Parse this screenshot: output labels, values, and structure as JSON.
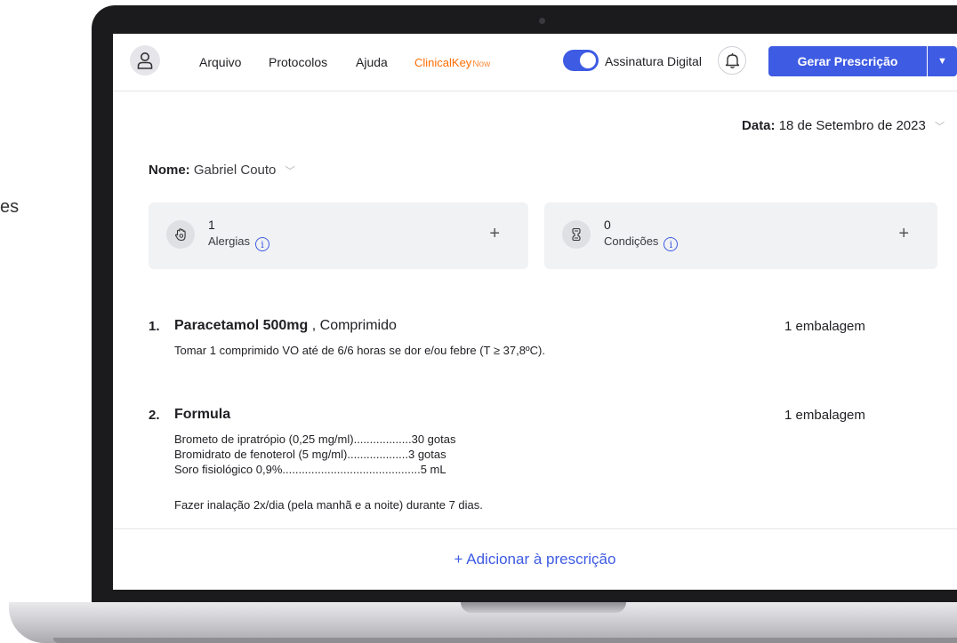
{
  "side_fragment": "es",
  "header": {
    "nav": [
      "Arquivo",
      "Protocolos",
      "Ajuda"
    ],
    "clinicalkey": {
      "main": "ClinicalKey",
      "suffix": "Now"
    },
    "toggle_label": "Assinatura Digital",
    "toggle_on": true,
    "primary_button": "Gerar Prescrição",
    "dropdown_glyph": "▼"
  },
  "date": {
    "label": "Data:",
    "value": "18 de Setembro de 2023"
  },
  "patient": {
    "label": "Nome:",
    "value": "Gabriel Couto"
  },
  "cards": [
    {
      "count": "1",
      "label": "Alergias",
      "icon": "hand-icon",
      "plus": "+"
    },
    {
      "count": "0",
      "label": "Condições",
      "icon": "condition-icon",
      "plus": "+"
    }
  ],
  "prescription": [
    {
      "num": "1.",
      "name": "Paracetamol 500mg",
      "form": " , Comprimido",
      "qty": "1 embalagem",
      "instructions": "Tomar 1 comprimido VO até de 6/6 horas se dor e/ou febre (T ≥ 37,8ºC)."
    },
    {
      "num": "2.",
      "name": "Formula",
      "qty": "1 embalagem",
      "components": [
        "Brometo de ipratrópio (0,25 mg/ml)..................30 gotas",
        "Bromidrato de fenoterol (5 mg/ml)...................3 gotas",
        "Soro fisiológico 0,9%...........................................5 mL"
      ],
      "instructions": "Fazer inalação 2x/dia (pela manhã e a noite) durante 7 dias."
    }
  ],
  "add_link": "+ Adicionar à prescrição",
  "chevron": "﹀",
  "info_glyph": "i"
}
